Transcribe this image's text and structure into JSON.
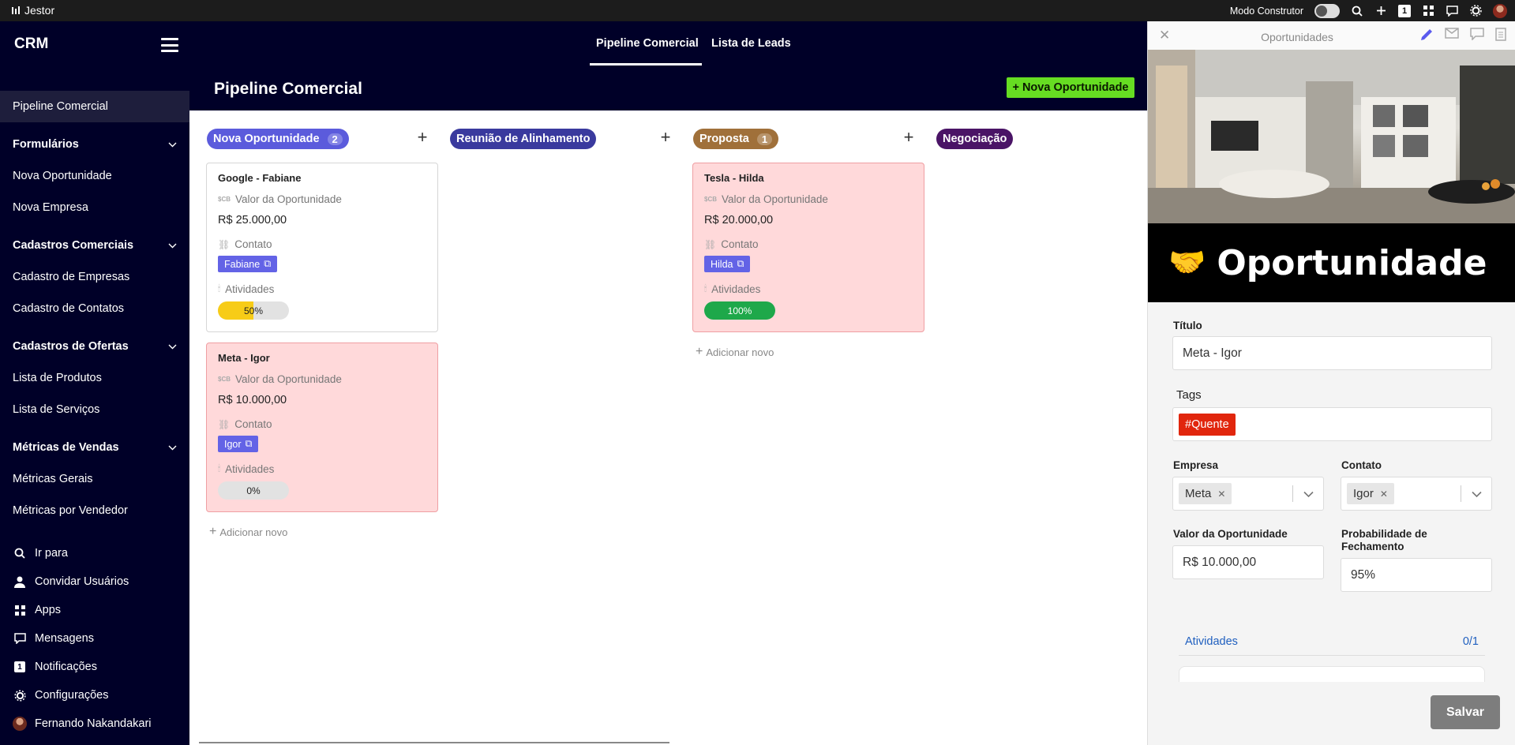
{
  "topbar": {
    "brand": "Jestor",
    "builder_mode_label": "Modo Construtor",
    "notification_count": "1"
  },
  "sidebar": {
    "title": "CRM",
    "items": [
      {
        "label": "Pipeline Comercial"
      },
      {
        "label": "Formulários"
      },
      {
        "label": "Nova Oportunidade"
      },
      {
        "label": "Nova Empresa"
      },
      {
        "label": "Cadastros Comerciais"
      },
      {
        "label": "Cadastro de Empresas"
      },
      {
        "label": "Cadastro de Contatos"
      },
      {
        "label": "Cadastros de Ofertas"
      },
      {
        "label": "Lista de Produtos"
      },
      {
        "label": "Lista de Serviços"
      },
      {
        "label": "Métricas de Vendas"
      },
      {
        "label": "Métricas Gerais"
      },
      {
        "label": "Métricas por Vendedor"
      }
    ],
    "bottom": [
      {
        "label": "Ir para",
        "icon": "search-icon"
      },
      {
        "label": "Convidar Usuários",
        "icon": "user-icon"
      },
      {
        "label": "Apps",
        "icon": "apps-grid-icon"
      },
      {
        "label": "Mensagens",
        "icon": "chat-icon"
      },
      {
        "label": "Notificações",
        "icon": "notification-badge",
        "badge": "1"
      },
      {
        "label": "Configurações",
        "icon": "gear-icon"
      },
      {
        "label": "Fernando Nakandakari",
        "icon": "avatar"
      }
    ]
  },
  "header": {
    "tabs": [
      {
        "label": "Pipeline Comercial",
        "active": true
      },
      {
        "label": "Lista de Leads",
        "active": false
      }
    ],
    "page_title": "Pipeline Comercial",
    "new_button": "Nova Oportunidade"
  },
  "board": {
    "columns": [
      {
        "name": "Nova Oportunidade",
        "count": "2",
        "color": "#5b5bdc"
      },
      {
        "name": "Reunião de Alinhamento",
        "count": "",
        "color": "#3a3a9e"
      },
      {
        "name": "Proposta",
        "count": "1",
        "color": "#a0703a"
      },
      {
        "name": "Negociação",
        "count": "",
        "color": "#4a1466"
      }
    ],
    "card_labels": {
      "value": "Valor da Oportunidade",
      "contact": "Contato",
      "activities": "Atividades"
    },
    "cards": [
      {
        "title": "Google - Fabiane",
        "value": "R$ 25.000,00",
        "contact": "Fabiane",
        "progress_label": "50%",
        "progress": 0.5,
        "progress_color": "#f7cc17"
      },
      {
        "title": "Meta - Igor",
        "value": "R$ 10.000,00",
        "contact": "Igor",
        "progress_label": "0%",
        "progress": 0,
        "progress_color": "#e2e2e2"
      },
      {
        "title": "Tesla - Hilda",
        "value": "R$ 20.000,00",
        "contact": "Hilda",
        "progress_label": "100%",
        "progress": 1,
        "progress_color": "#1ea84a"
      }
    ],
    "add_new": "Adicionar novo"
  },
  "panel": {
    "title": "Oportunidades",
    "hero_emoji": "🤝",
    "hero_title": "Oportunidade",
    "fields": {
      "title_label": "Título",
      "title_value": "Meta - Igor",
      "tags_label": "Tags",
      "tag": "#Quente",
      "company_label": "Empresa",
      "company_value": "Meta",
      "contact_label": "Contato",
      "contact_value": "Igor",
      "value_label": "Valor da Oportunidade",
      "value_value": "R$ 10.000,00",
      "prob_label": "Probabilidade de Fechamento",
      "prob_value": "95%"
    },
    "activities_label": "Atividades",
    "activities_count": "0/1",
    "save_button": "Salvar"
  }
}
